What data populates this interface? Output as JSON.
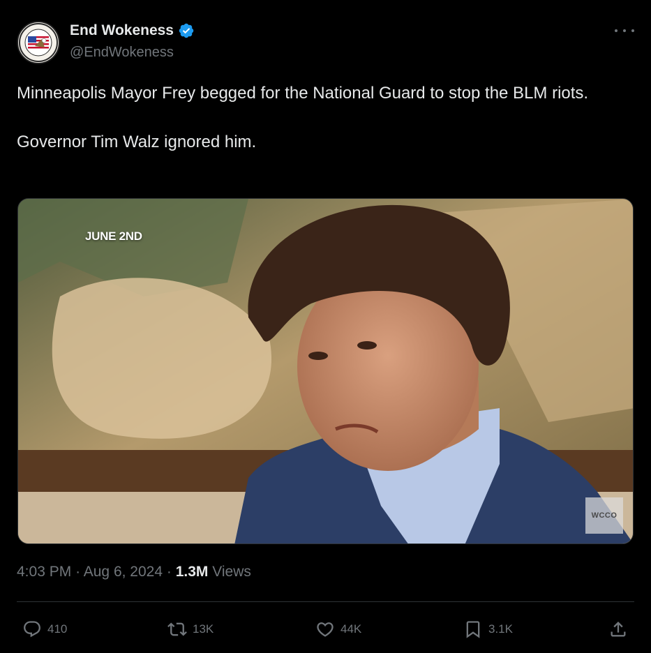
{
  "author": {
    "display_name": "End Wokeness",
    "handle": "@EndWokeness",
    "verified": true,
    "avatar_icon": "eagle-flag-badge-avatar"
  },
  "tweet": {
    "paragraphs": [
      "Minneapolis Mayor Frey begged for the National Guard to stop the BLM riots.",
      "Governor Tim Walz ignored him."
    ]
  },
  "media": {
    "overlay_text": "JUNE 2ND",
    "watermark": "WCCO"
  },
  "meta": {
    "time": "4:03 PM",
    "separator": "·",
    "date": "Aug 6, 2024",
    "views_count": "1.3M",
    "views_label": "Views"
  },
  "actions": {
    "replies": "410",
    "reposts": "13K",
    "likes": "44K",
    "bookmarks": "3.1K"
  },
  "colors": {
    "background": "#000000",
    "text": "#e7e9ea",
    "secondary": "#71767b",
    "verified": "#1d9bf0",
    "divider": "#2f3336"
  }
}
